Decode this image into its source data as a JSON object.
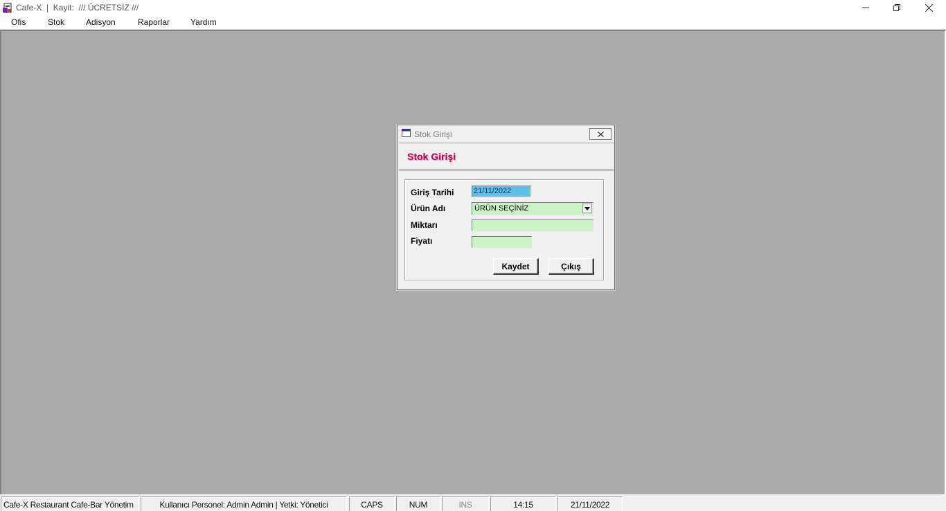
{
  "window": {
    "title": "Cafe-X  |  Kayit:  /// ÜCRETSİZ ///",
    "minimize_glyph": "—",
    "maximize_glyph": "❐",
    "close_glyph": "✕"
  },
  "menu": {
    "items": [
      {
        "label": "Ofis"
      },
      {
        "label": "Stok"
      },
      {
        "label": "Adisyon"
      },
      {
        "label": "Raporlar"
      },
      {
        "label": "Yardım"
      }
    ]
  },
  "dialog": {
    "title": "Stok Girişi",
    "heading": "Stok Girişi",
    "close_glyph": "✕",
    "fields": {
      "date_label": "Giriş Tarihi",
      "date_value": "21/11/2022",
      "product_label": "Ürün Adı",
      "product_value": "ÜRÜN SEÇİNİZ",
      "quantity_label": "Miktarı",
      "quantity_value": "",
      "price_label": "Fiyatı",
      "price_value": ""
    },
    "buttons": {
      "save": "Kaydet",
      "exit": "Çıkış"
    }
  },
  "statusbar": {
    "app": "Cafe-X Restaurant Cafe-Bar Yönetim",
    "user": "Kullanıcı Personel: Admin Admin  |  Yetki: Yönetici",
    "caps": "CAPS",
    "num": "NUM",
    "ins": "INS",
    "time": "14:15",
    "date": "21/11/2022"
  },
  "colors": {
    "mdi_background": "#ababab",
    "heading": "#c0004c",
    "field_background": "#ccf2c8",
    "date_selection": "#5fc0ea"
  }
}
